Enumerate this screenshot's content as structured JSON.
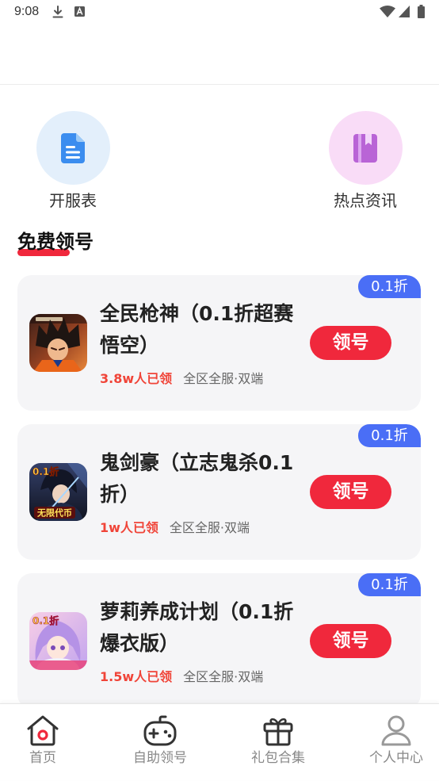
{
  "status_bar": {
    "time": "9:08",
    "icons": [
      "download-icon",
      "font-a-icon",
      "wifi-icon",
      "signal-icon",
      "battery-icon"
    ]
  },
  "colors": {
    "accent": "#f0283c",
    "badge": "#4a6ef6",
    "card_bg": "#f5f5f7",
    "claimed_text": "#f04438",
    "muted_text": "#666666"
  },
  "quick_entries": [
    {
      "label": "开服表",
      "icon": "document-icon",
      "icon_color": "#3b8def",
      "circle_color": "#e3effb"
    },
    {
      "label": "热点资讯",
      "icon": "book-icon",
      "icon_color": "#b964d6",
      "circle_color": "#f9dcf7"
    }
  ],
  "section": {
    "title": "免费领号"
  },
  "games": [
    {
      "title": "全民枪神（0.1折超赛悟空）",
      "badge": "0.1折",
      "claimed": "3.8w人已领",
      "scope": "全区全服·双端",
      "button": "领号"
    },
    {
      "title": "鬼剑豪（立志鬼杀0.1折）",
      "badge": "0.1折",
      "claimed": "1w人已领",
      "scope": "全区全服·双端",
      "button": "领号",
      "art_tags": {
        "top": "0.1折",
        "bottom": "无限代币"
      }
    },
    {
      "title": "萝莉养成计划（0.1折爆衣版）",
      "badge": "0.1折",
      "claimed": "1.5w人已领",
      "scope": "全区全服·双端",
      "button": "领号",
      "art_tags": {
        "top": "0.1折"
      }
    }
  ],
  "nav": [
    {
      "label": "首页",
      "icon": "home-icon",
      "active": true
    },
    {
      "label": "自助领号",
      "icon": "gamepad-icon",
      "active": false
    },
    {
      "label": "礼包合集",
      "icon": "gift-icon",
      "active": false
    },
    {
      "label": "个人中心",
      "icon": "user-icon",
      "active": false
    }
  ]
}
